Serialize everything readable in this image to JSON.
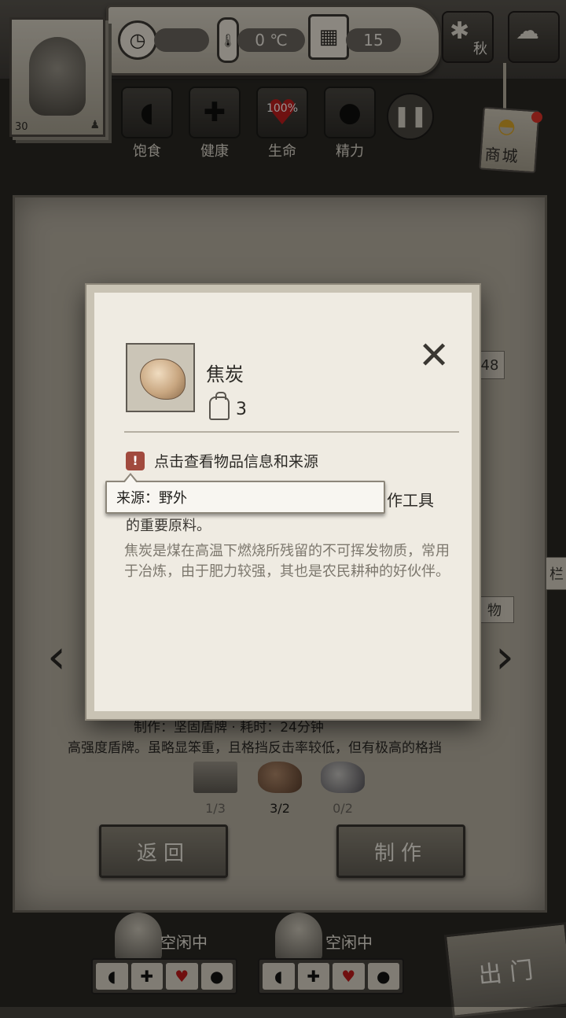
{
  "hud": {
    "level": "30",
    "temperature": "0 ℃",
    "day": "15",
    "season": "秋",
    "stats": [
      {
        "label": "饱食",
        "icon": "stomach-icon"
      },
      {
        "label": "健康",
        "icon": "health-cross-icon"
      },
      {
        "label": "生命",
        "icon": "heart-icon",
        "value": "100%"
      },
      {
        "label": "精力",
        "icon": "person-icon"
      }
    ],
    "shop_label": "商城",
    "colors": {
      "heart": "#c01e1e",
      "warn": "#a14a3e",
      "notify": "#e0342a"
    }
  },
  "background": {
    "partial_count": "48",
    "side_tab_right": "栏",
    "side_tag": "物",
    "recipe_line1": "制作：坚固盾牌 · 耗时：24分钟",
    "recipe_desc": "高强度盾牌。虽略显笨重，且格挡反击率较低，但有极高的格挡",
    "materials": [
      {
        "name": "wood-planks",
        "count": "1/3"
      },
      {
        "name": "coke-ore",
        "count": "3/2"
      },
      {
        "name": "iron-ore",
        "count": "0/2"
      }
    ],
    "back_button": "返回",
    "craft_button": "制作"
  },
  "survivors": [
    {
      "status": "空闲中"
    },
    {
      "status": "空闲中"
    }
  ],
  "exit_button": "出门",
  "modal": {
    "item_name": "焦炭",
    "quantity": "3",
    "info_prompt": "点击查看物品信息和来源",
    "partial_right": "作工具",
    "partial_line": "的重要原料。",
    "description": "焦炭是煤在高温下燃烧所残留的不可挥发物质，常用于冶炼，由于肥力较强，其也是农民耕种的好伙伴。",
    "tooltip": "来源：野外"
  }
}
